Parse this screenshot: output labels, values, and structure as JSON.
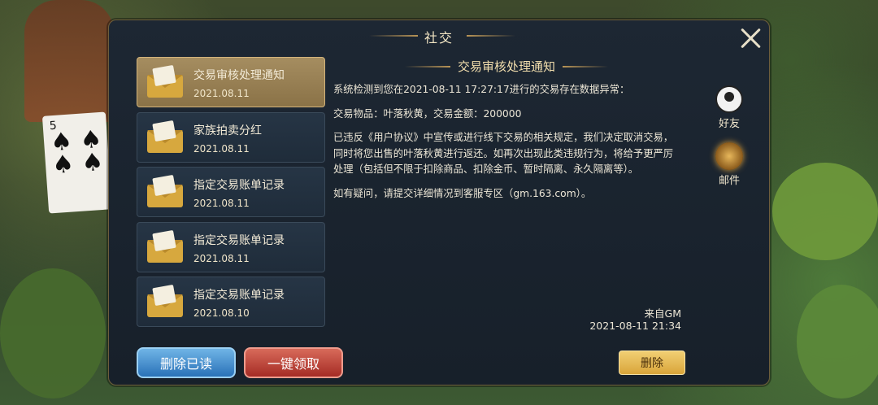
{
  "panel": {
    "title": "社交"
  },
  "mails": [
    {
      "title": "交易审核处理通知",
      "date": "2021.08.11",
      "selected": true
    },
    {
      "title": "家族拍卖分红",
      "date": "2021.08.11",
      "selected": false
    },
    {
      "title": "指定交易账单记录",
      "date": "2021.08.11",
      "selected": false
    },
    {
      "title": "指定交易账单记录",
      "date": "2021.08.11",
      "selected": false
    },
    {
      "title": "指定交易账单记录",
      "date": "2021.08.10",
      "selected": false
    }
  ],
  "content": {
    "title": "交易审核处理通知",
    "paragraphs": [
      "系统检测到您在2021-08-11  17:27:17进行的交易存在数据异常：",
      "交易物品：叶落秋黄，交易金额：200000",
      "已违反《用户协议》中宣传或进行线下交易的相关规定，我们决定取消交易，同时将您出售的叶落秋黄进行返还。如再次出现此类违规行为，将给予更严厉处理（包括但不限于扣除商品、扣除金币、暂时隔离、永久隔离等）。",
      "如有疑问，请提交详细情况到客服专区（gm.163.com）。"
    ],
    "sender": "来自GM",
    "sent_time": "2021-08-11  21:34"
  },
  "tabs": {
    "friends": "好友",
    "mail": "邮件"
  },
  "buttons": {
    "delete_read": "删除已读",
    "claim_all": "一键领取",
    "delete": "删除"
  },
  "background": {
    "card_rank": "5"
  },
  "colors": {
    "selected_item": "#a58d60",
    "claim_button": "#a52c25",
    "delete_read_button": "#2a72b8",
    "delete_button": "#e4b650"
  }
}
